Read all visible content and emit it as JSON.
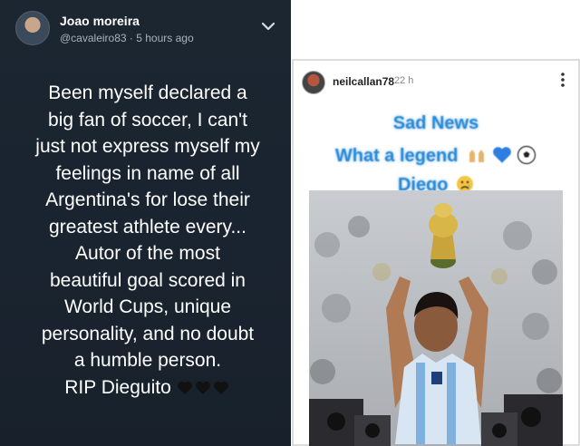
{
  "left_post": {
    "username": "Joao moreira",
    "handle": "@cavaleiro83",
    "time_sep": " · ",
    "time": "5 hours ago",
    "lines": [
      "Been myself declared a",
      "big fan of soccer, I can't",
      "just not express myself my",
      "feelings in name of all",
      "Argentina's for lose their",
      "greatest athlete every...",
      "Autor of the most",
      "beautiful goal scored in",
      "World Cups, unique",
      "personality, and no doubt",
      "a humble person.",
      "RIP Dieguito"
    ],
    "hearts": [
      "black-heart-icon",
      "black-heart-icon",
      "black-heart-icon"
    ],
    "colors": {
      "background": "#1c2631",
      "text": "#ffffff",
      "subtext": "#aab3bc"
    }
  },
  "right_post": {
    "username": "neilcallan78",
    "time": "22 h",
    "overlay": {
      "line1": "Sad News",
      "line2": "What a legend",
      "line3": "Diego",
      "color": "#2a8bd6"
    },
    "icons": [
      "raising-hands-icon",
      "blue-heart-icon",
      "soccer-ball-icon",
      "crying-face-icon",
      "more-vertical-icon"
    ]
  }
}
